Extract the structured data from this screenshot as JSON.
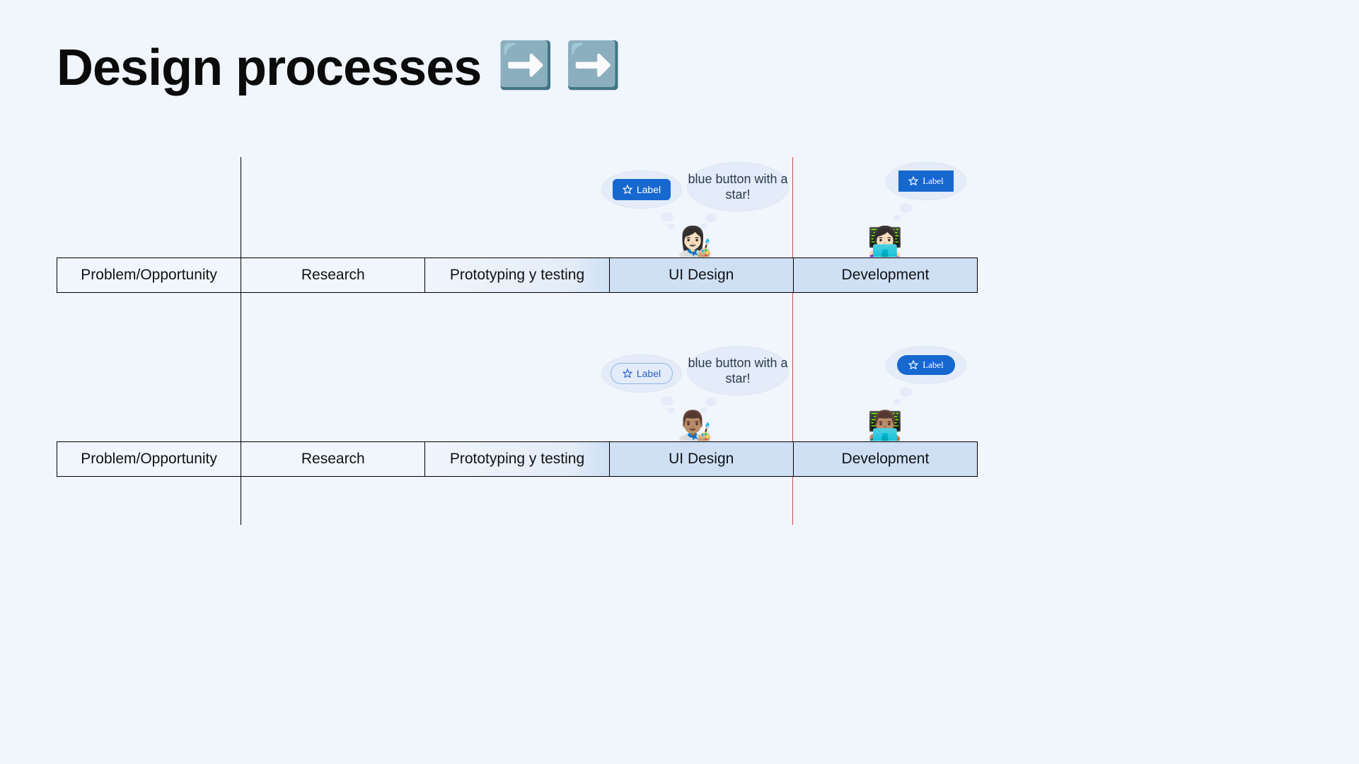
{
  "title_text": "Design processes",
  "title_emoji": "➡️ ➡️",
  "stages": [
    "Problem/Opportunity",
    "Research",
    "Prototyping y testing",
    "UI Design",
    "Development"
  ],
  "speech": "blue button with a star!",
  "label": "Label",
  "personas": {
    "artist1": "👩🏻‍🎨",
    "dev1": "👩🏻‍💻",
    "artist2": "👨🏽‍🎨",
    "dev2": "👨🏽‍💻"
  }
}
